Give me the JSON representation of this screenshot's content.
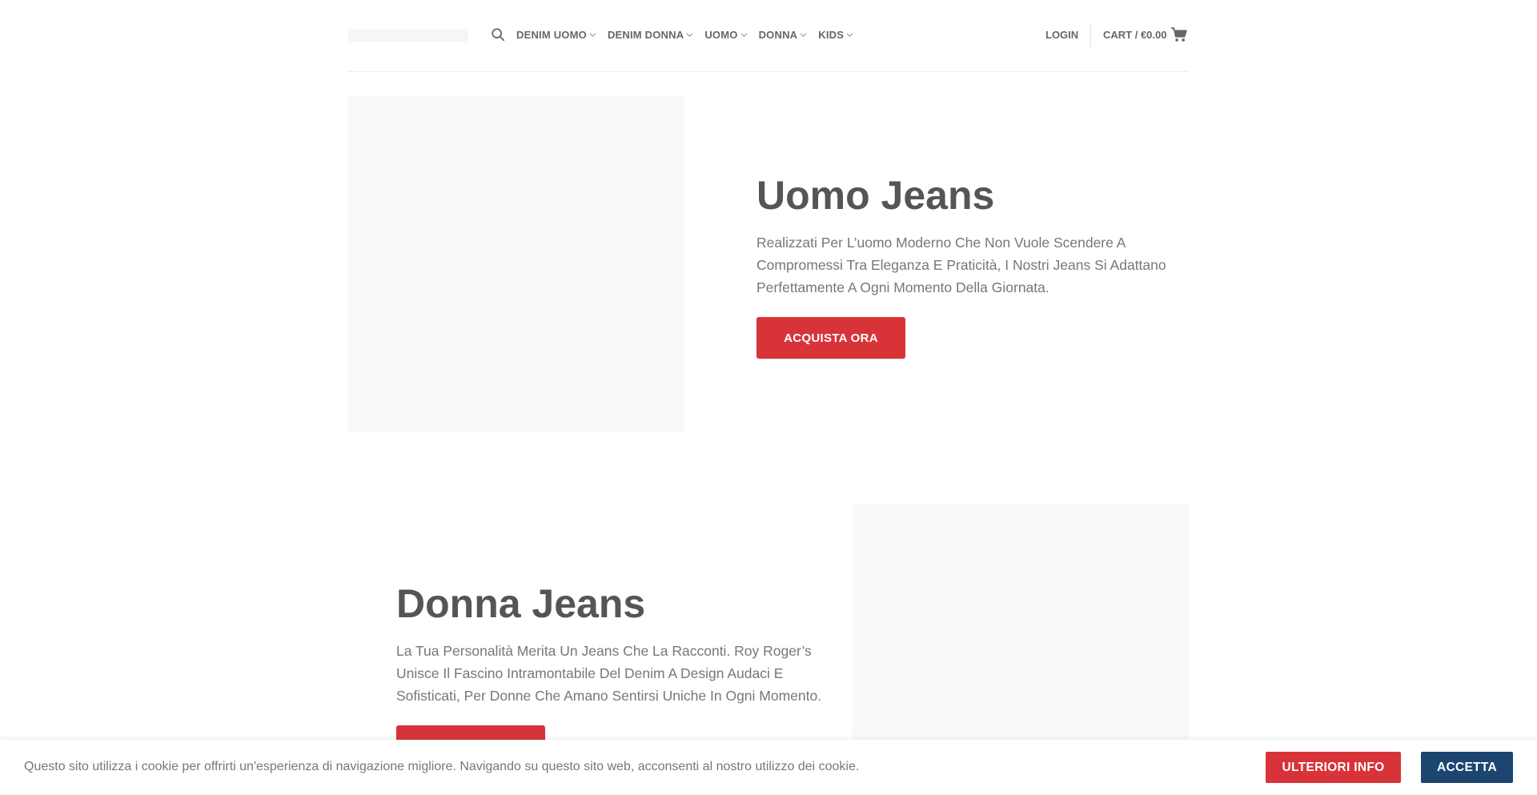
{
  "header": {
    "nav": [
      {
        "label": "DENIM UOMO"
      },
      {
        "label": "DENIM DONNA"
      },
      {
        "label": "UOMO"
      },
      {
        "label": "DONNA"
      },
      {
        "label": "KIDS"
      }
    ],
    "login_label": "LOGIN",
    "cart_label": "CART / €0.00"
  },
  "sections": {
    "uomo": {
      "title": "Uomo Jeans",
      "description": "Realizzati Per L’uomo Moderno Che Non Vuole Scendere A Compromessi Tra Eleganza E Praticità, I Nostri Jeans Si Adattano Perfettamente A Ogni Momento Della Giornata.",
      "button_label": "ACQUISTA ORA"
    },
    "donna": {
      "title": "Donna Jeans",
      "description": "La Tua Personalità Merita Un Jeans Che La Racconti. Roy Roger’s Unisce Il Fascino Intramontabile Del Denim A Design Audaci E Sofisticati, Per Donne Che Amano Sentirsi Uniche In Ogni Momento."
    }
  },
  "cookie_bar": {
    "text": "Questo sito utilizza i cookie per offrirti un'esperienza di navigazione migliore. Navigando su questo sito web, acconsenti al nostro utilizzo dei cookie.",
    "info_label": "ULTERIORI INFO",
    "accept_label": "ACCETTA"
  },
  "colors": {
    "accent_red": "#d9333a",
    "accept_navy": "#1c4670",
    "text": "#555555"
  },
  "icons": [
    "search-icon",
    "chevron-down-icon",
    "cart-icon"
  ]
}
